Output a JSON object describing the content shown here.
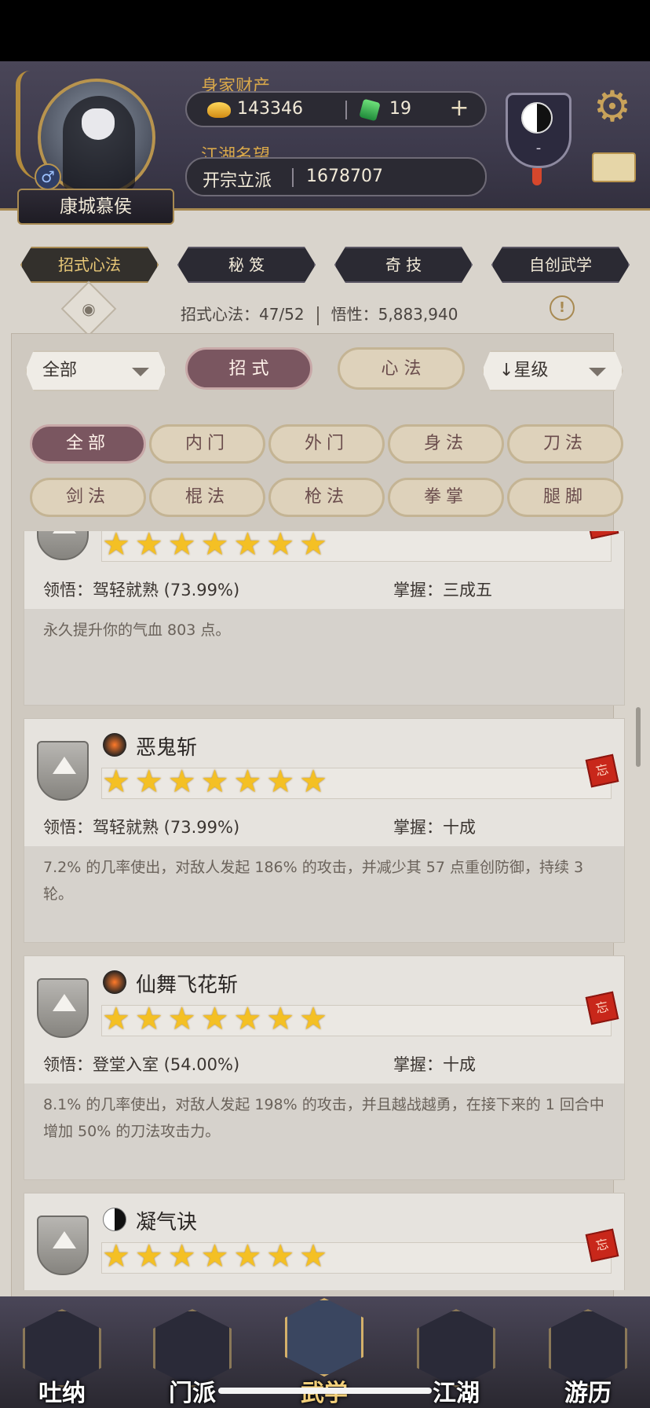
{
  "player": {
    "name": "康城慕侯",
    "gender_icon": "male-icon"
  },
  "wealth": {
    "label": "身家财产",
    "gold": "143346",
    "jade": "19",
    "add_icon": "plus-icon"
  },
  "fame": {
    "label": "江湖名望",
    "rank": "开宗立派",
    "value": "1678707"
  },
  "sect_emblem": {
    "text": "-"
  },
  "tabs": [
    "招式心法",
    "秘 笈",
    "奇 技",
    "自创武学"
  ],
  "stats": {
    "moves": "招式心法：47/52",
    "insight": "悟性：5,883,940"
  },
  "filters": {
    "dropdown_all": "全部",
    "seg_moves": "招 式",
    "seg_mind": "心 法",
    "sort": "星级",
    "categories_row1": [
      "全部",
      "内门",
      "外门",
      "身法",
      "刀法"
    ],
    "categories_row2": [
      "剑法",
      "棍法",
      "枪法",
      "拳掌",
      "腿脚"
    ]
  },
  "skills": [
    {
      "name": "",
      "stars": "★★★★★★★",
      "insight": "领悟：驾轻就熟 (73.99%)",
      "mastery": "掌握：三成五",
      "desc": "永久提升你的气血 803 点。",
      "seal": "忘"
    },
    {
      "name": "恶鬼斩",
      "stars": "★★★★★★★",
      "insight": "领悟：驾轻就熟 (73.99%)",
      "mastery": "掌握：十成",
      "desc": "7.2% 的几率使出，对敌人发起 186% 的攻击，并减少其 57 点重创防御，持续 3 轮。",
      "seal": "忘"
    },
    {
      "name": "仙舞飞花斩",
      "stars": "★★★★★★★",
      "insight": "领悟：登堂入室 (54.00%)",
      "mastery": "掌握：十成",
      "desc": "8.1% 的几率使出，对敌人发起 198% 的攻击，并且越战越勇，在接下来的 1 回合中增加 50% 的刀法攻击力。",
      "seal": "忘"
    },
    {
      "name": "凝气诀",
      "stars": "★★★★★★★",
      "seal": "忘"
    }
  ],
  "nav": [
    "吐纳",
    "门派",
    "武学",
    "江湖",
    "游历"
  ]
}
